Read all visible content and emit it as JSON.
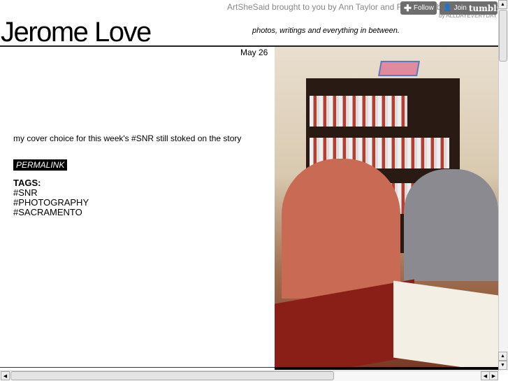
{
  "header": {
    "credit": "ArtSheSaid brought to you by Ann Taylor and Flavorbilly branding and design",
    "credit_by": "by ALLDAYEVERYDAY",
    "follow_label": "Follow",
    "join_label": "Join",
    "tumblr_label": "tumblr.",
    "title": "Jerome Love",
    "tagline": "photos, writings and everything in between."
  },
  "post": {
    "date": "May 26",
    "caption": "my cover choice for this week's #SNR still stoked on the story",
    "permalink": "PERMALINK",
    "tags_heading": "TAGS:",
    "tags": [
      "#SNR",
      "#PHOTOGRAPHY",
      "#SACRAMENTO"
    ]
  }
}
